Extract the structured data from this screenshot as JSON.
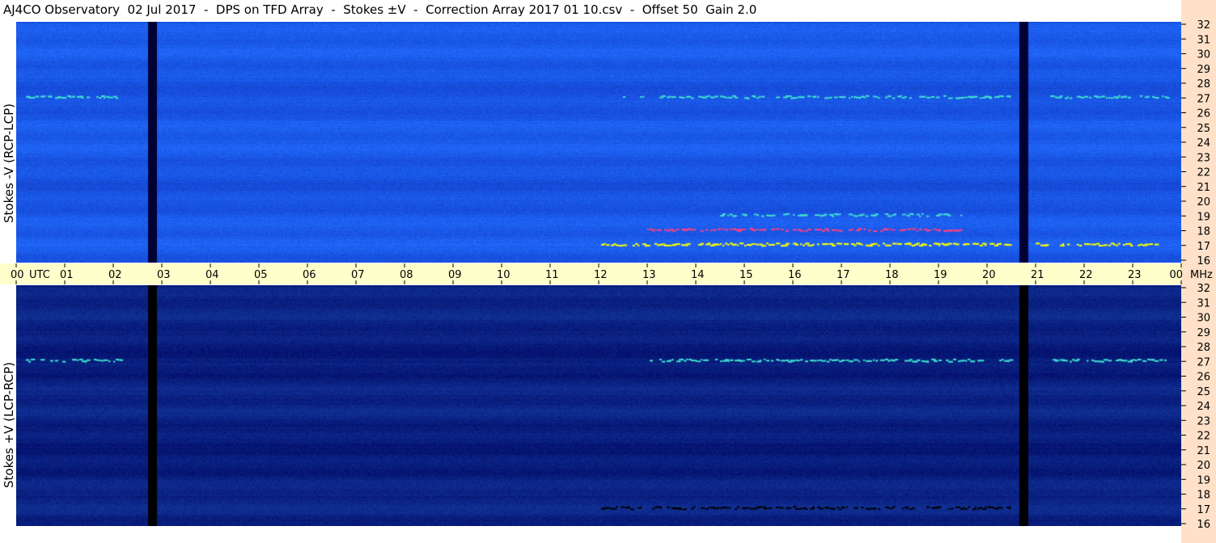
{
  "title": "AJ4CO Observatory  02 Jul 2017  -  DPS on TFD Array  -  Stokes ±V  -  Correction Array 2017 01 10.csv  -  Offset 50  Gain 2.0",
  "chart_data": {
    "type": "heatmap",
    "panels": [
      {
        "name": "top",
        "ylabel": "Stokes -V (RCP-LCP)",
        "baseline_color": "#1a57e6",
        "features": [
          {
            "type": "vertical_band",
            "hour": 2.8,
            "color": "#000033"
          },
          {
            "type": "vertical_band",
            "hour": 20.75,
            "color": "#000033"
          },
          {
            "type": "horizontal_band",
            "mhz": 27,
            "hours": [
              0.2,
              2.2
            ],
            "color": "#40e0d0"
          },
          {
            "type": "horizontal_band",
            "mhz": 27,
            "hours": [
              12.5,
              20.5
            ],
            "color": "#40e0d0"
          },
          {
            "type": "horizontal_band",
            "mhz": 27,
            "hours": [
              21.3,
              23.8
            ],
            "color": "#40e0d0"
          },
          {
            "type": "horizontal_band",
            "mhz": 18,
            "hours": [
              13,
              19.5
            ],
            "color": "#ff4080"
          },
          {
            "type": "horizontal_band",
            "mhz": 17,
            "hours": [
              12,
              20.5
            ],
            "color": "#ffff00"
          },
          {
            "type": "horizontal_band",
            "mhz": 17,
            "hours": [
              21,
              23.5
            ],
            "color": "#ffff00"
          },
          {
            "type": "horizontal_band",
            "mhz": 19,
            "hours": [
              14.5,
              19.5
            ],
            "color": "#40e0d0"
          }
        ]
      },
      {
        "name": "bottom",
        "ylabel": "Stokes +V (LCP-RCP)",
        "baseline_color": "#0a2080",
        "features": [
          {
            "type": "vertical_band",
            "hour": 2.8,
            "color": "#000000"
          },
          {
            "type": "vertical_band",
            "hour": 20.75,
            "color": "#000000"
          },
          {
            "type": "horizontal_band",
            "mhz": 27,
            "hours": [
              0.2,
              2.2
            ],
            "color": "#40e0d0"
          },
          {
            "type": "horizontal_band",
            "mhz": 27,
            "hours": [
              13,
              20.5
            ],
            "color": "#40e0d0"
          },
          {
            "type": "horizontal_band",
            "mhz": 27,
            "hours": [
              21.3,
              23.8
            ],
            "color": "#40e0d0"
          },
          {
            "type": "horizontal_band",
            "mhz": 17,
            "hours": [
              12,
              20.5
            ],
            "color": "#000000"
          }
        ]
      }
    ],
    "x_axis": {
      "unit_label": "UTC",
      "ticks": [
        "00",
        "01",
        "02",
        "03",
        "04",
        "05",
        "06",
        "07",
        "08",
        "09",
        "10",
        "11",
        "12",
        "13",
        "14",
        "15",
        "16",
        "17",
        "18",
        "19",
        "20",
        "21",
        "22",
        "23",
        "00"
      ],
      "range": [
        0,
        24
      ]
    },
    "y_axis": {
      "unit_label": "MHz",
      "ticks": [
        "32",
        "31",
        "30",
        "29",
        "28",
        "27",
        "26",
        "25",
        "24",
        "23",
        "22",
        "21",
        "20",
        "19",
        "18",
        "17",
        "16"
      ],
      "range": [
        16,
        32
      ]
    },
    "colors": {
      "axis_bg": "#ffffcc",
      "right_strip_bg": "#ffe0c8"
    }
  }
}
